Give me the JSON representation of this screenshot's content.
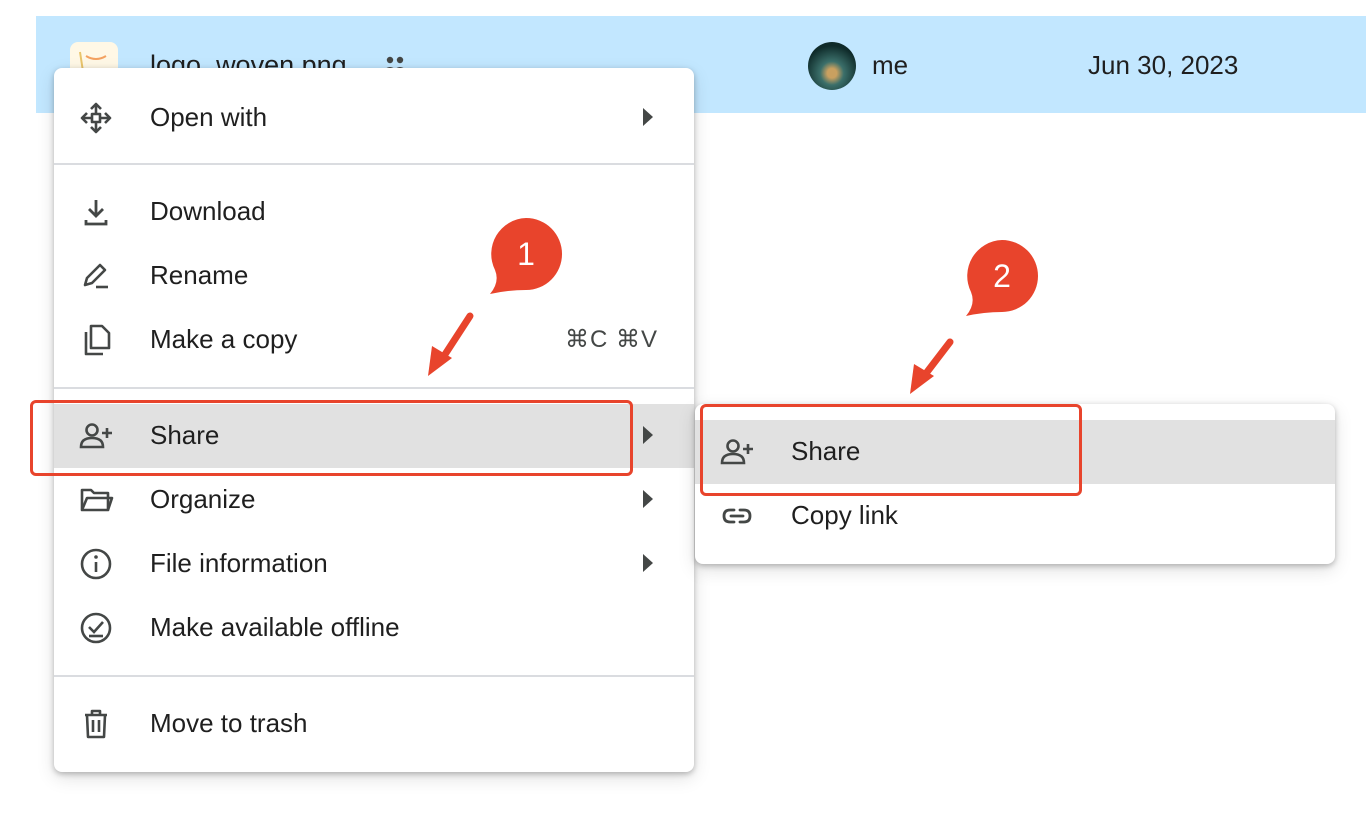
{
  "file_row": {
    "name": "logo_woven.png",
    "owner": "me",
    "modified": "Jun 30, 2023"
  },
  "context_menu": {
    "items": [
      {
        "label": "Open with",
        "icon": "open-with-icon",
        "has_submenu": true
      },
      {
        "label": "Download",
        "icon": "download-icon"
      },
      {
        "label": "Rename",
        "icon": "rename-pencil-icon"
      },
      {
        "label": "Make a copy",
        "icon": "copy-icon",
        "shortcut": "⌘C ⌘V"
      },
      {
        "label": "Share",
        "icon": "person-add-icon",
        "has_submenu": true,
        "highlighted": true
      },
      {
        "label": "Organize",
        "icon": "folder-icon",
        "has_submenu": true
      },
      {
        "label": "File information",
        "icon": "info-icon",
        "has_submenu": true
      },
      {
        "label": "Make available offline",
        "icon": "offline-check-icon"
      },
      {
        "label": "Move to trash",
        "icon": "trash-icon"
      }
    ]
  },
  "share_submenu": {
    "items": [
      {
        "label": "Share",
        "icon": "person-add-icon",
        "highlighted": true
      },
      {
        "label": "Copy link",
        "icon": "link-icon"
      }
    ]
  },
  "annotations": {
    "step1": "1",
    "step2": "2",
    "accent_color": "#e8442c"
  },
  "colors": {
    "selected_row": "#c2e7ff",
    "hover_item": "#e1e1e1"
  }
}
